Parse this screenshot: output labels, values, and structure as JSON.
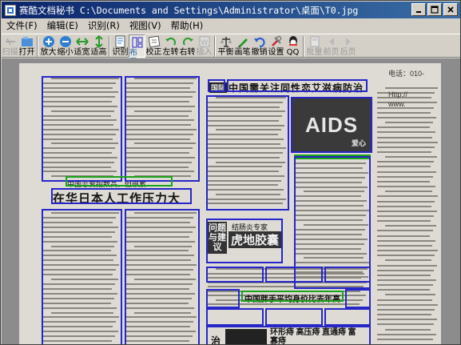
{
  "window": {
    "title": "赛酷文档秘书 C:\\Documents and Settings\\Administrator\\桌面\\T0.jpg"
  },
  "menu": {
    "items": [
      {
        "label": "文件(F)"
      },
      {
        "label": "编辑(E)"
      },
      {
        "label": "识别(R)"
      },
      {
        "label": "视图(V)"
      },
      {
        "label": "帮助(H)"
      }
    ]
  },
  "toolbar": {
    "buttons": [
      {
        "label": "扫描",
        "icon": "scan-icon",
        "disabled": true
      },
      {
        "label": "打开",
        "icon": "open-icon"
      },
      {
        "label": "放大",
        "icon": "zoom-in-icon"
      },
      {
        "label": "缩小",
        "icon": "zoom-out-icon"
      },
      {
        "label": "适宽",
        "icon": "fit-width-icon"
      },
      {
        "label": "适高",
        "icon": "fit-height-icon"
      },
      {
        "label": "识别",
        "icon": "recognize-icon"
      },
      {
        "label": "布局",
        "icon": "layout-icon",
        "active": true
      },
      {
        "label": "校正",
        "icon": "correct-icon"
      },
      {
        "label": "左转",
        "icon": "rotate-left-icon"
      },
      {
        "label": "右转",
        "icon": "rotate-right-icon"
      },
      {
        "label": "插入",
        "icon": "insert-icon",
        "disabled": true
      },
      {
        "label": "平衡",
        "icon": "balance-icon"
      },
      {
        "label": "画笔",
        "icon": "pen-icon"
      },
      {
        "label": "撤销",
        "icon": "undo-icon"
      },
      {
        "label": "设置",
        "icon": "settings-icon"
      },
      {
        "label": "QQ",
        "icon": "qq-icon"
      },
      {
        "label": "批量",
        "icon": "batch-icon",
        "disabled": true
      },
      {
        "label": "前页",
        "icon": "prev-page-icon",
        "disabled": true
      },
      {
        "label": "后页",
        "icon": "next-page-icon",
        "disabled": true
      }
    ]
  },
  "document": {
    "headline_main": "在华日本人工作压力大",
    "headline_center": "中国需关注同性恋艾滋病防治",
    "headline_small_left": "中国恋爱指数高，但很累",
    "headline_bottom": "中国胖手平均身价比去年高",
    "tag_top": "国际",
    "photo_label": "AIDS",
    "photo_caption": "爱心",
    "ad_brand": "虎地胶囊",
    "ad_title": "结肠炎专家",
    "ad_side": "问题与建议",
    "ad_bottom_left": "治",
    "ad_bottom_right": "环形痔 高压痔 直通痔 富寡痔",
    "right_strip": [
      "电话：010-",
      "Http://",
      "www."
    ]
  },
  "colors": {
    "zone_border": "#2626c9",
    "zone_green": "#1ba31b",
    "titlebar_start": "#0a246a",
    "titlebar_end": "#3a6ea5"
  }
}
